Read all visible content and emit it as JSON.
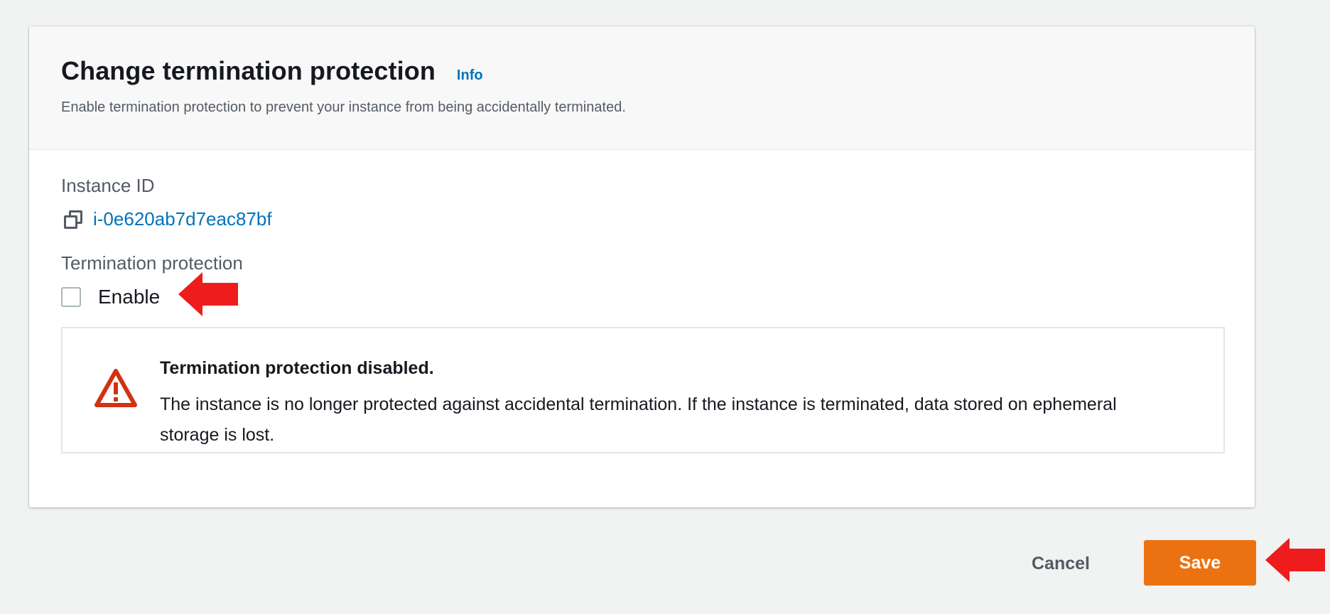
{
  "panel": {
    "title": "Change termination protection",
    "info_link": "Info",
    "description": "Enable termination protection to prevent your instance from being accidentally terminated."
  },
  "instance": {
    "label": "Instance ID",
    "id": "i-0e620ab7d7eac87bf",
    "copy_icon": "copy-icon"
  },
  "protection": {
    "label": "Termination protection",
    "checkbox_label": "Enable",
    "checked": false
  },
  "alert": {
    "type": "warning",
    "icon": "warning-triangle-icon",
    "title": "Termination protection disabled.",
    "body": "The instance is no longer protected against accidental termination. If the instance is terminated, data stored on ephemeral storage is lost."
  },
  "actions": {
    "cancel_label": "Cancel",
    "save_label": "Save"
  },
  "annotations": {
    "arrow_color": "#ee1c1c"
  },
  "colors": {
    "accent_link": "#0073bb",
    "primary_button": "#ec7211",
    "warning": "#d13212"
  }
}
